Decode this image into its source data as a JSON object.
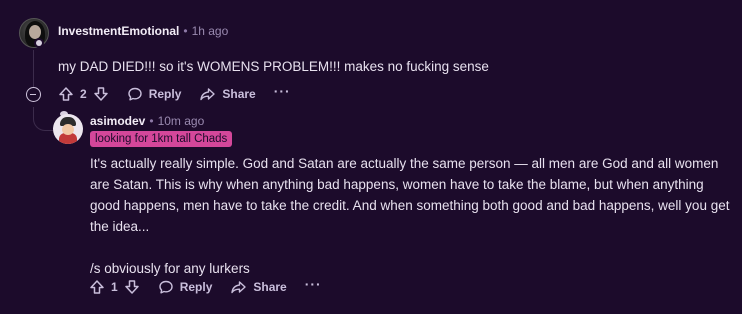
{
  "comment1": {
    "username": "InvestmentEmotional",
    "separator": "•",
    "timestamp": "1h ago",
    "body": "my DAD DIED!!! so it's WOMENS PROBLEM!!! makes no fucking sense",
    "votes": "2",
    "reply_label": "Reply",
    "share_label": "Share",
    "more_label": "···"
  },
  "comment2": {
    "username": "asimodev",
    "separator": "•",
    "timestamp": "10m ago",
    "flair": "looking for 1km tall Chads",
    "body_paragraph_1": "It's actually really simple. God and Satan are actually the same person — all men are God and all women are Satan. This is why when anything bad happens, women have to take the blame, but when anything good happens, men have to take the credit. And when something both good and bad happens, well you get the idea...",
    "body_paragraph_2": "/s obviously for any lurkers",
    "votes": "1",
    "reply_label": "Reply",
    "share_label": "Share",
    "more_label": "···"
  },
  "colors": {
    "background": "#1c0b2b",
    "flair_background": "#d4479a",
    "timestamp": "#9a8ab0",
    "thread_line": "#3c2c4c"
  },
  "icons": [
    "avatar",
    "collapse-icon",
    "upvote-icon",
    "downvote-icon",
    "reply-icon",
    "share-icon",
    "more-icon"
  ]
}
